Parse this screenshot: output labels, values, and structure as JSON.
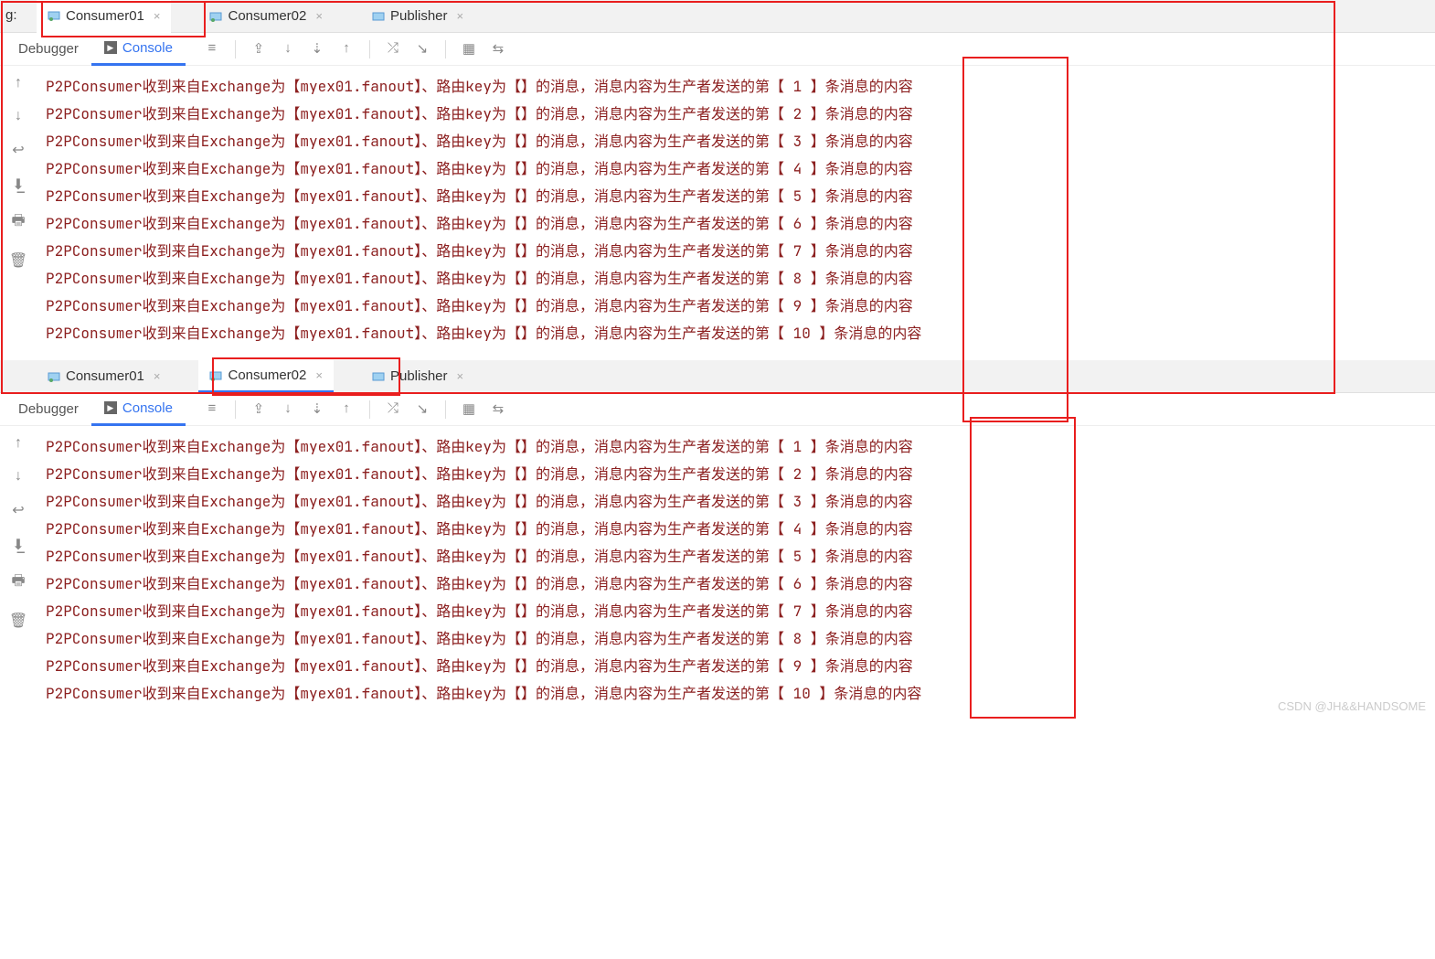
{
  "tabs": {
    "prefix": "g:",
    "t1": "Consumer01",
    "t2": "Consumer02",
    "t3": "Publisher"
  },
  "toolTabs": {
    "debugger": "Debugger",
    "console": "Console"
  },
  "console1": {
    "lines": [
      "P2PConsumer收到来自Exchange为【myex01.fanout】、路由key为【】的消息，消息内容为生产者发送的第【 1 】条消息的内容",
      "P2PConsumer收到来自Exchange为【myex01.fanout】、路由key为【】的消息，消息内容为生产者发送的第【 2 】条消息的内容",
      "P2PConsumer收到来自Exchange为【myex01.fanout】、路由key为【】的消息，消息内容为生产者发送的第【 3 】条消息的内容",
      "P2PConsumer收到来自Exchange为【myex01.fanout】、路由key为【】的消息，消息内容为生产者发送的第【 4 】条消息的内容",
      "P2PConsumer收到来自Exchange为【myex01.fanout】、路由key为【】的消息，消息内容为生产者发送的第【 5 】条消息的内容",
      "P2PConsumer收到来自Exchange为【myex01.fanout】、路由key为【】的消息，消息内容为生产者发送的第【 6 】条消息的内容",
      "P2PConsumer收到来自Exchange为【myex01.fanout】、路由key为【】的消息，消息内容为生产者发送的第【 7 】条消息的内容",
      "P2PConsumer收到来自Exchange为【myex01.fanout】、路由key为【】的消息，消息内容为生产者发送的第【 8 】条消息的内容",
      "P2PConsumer收到来自Exchange为【myex01.fanout】、路由key为【】的消息，消息内容为生产者发送的第【 9 】条消息的内容",
      "P2PConsumer收到来自Exchange为【myex01.fanout】、路由key为【】的消息，消息内容为生产者发送的第【 10 】条消息的内容"
    ]
  },
  "console2": {
    "lines": [
      "P2PConsumer收到来自Exchange为【myex01.fanout】、路由key为【】的消息，消息内容为生产者发送的第【 1 】条消息的内容",
      "P2PConsumer收到来自Exchange为【myex01.fanout】、路由key为【】的消息，消息内容为生产者发送的第【 2 】条消息的内容",
      "P2PConsumer收到来自Exchange为【myex01.fanout】、路由key为【】的消息，消息内容为生产者发送的第【 3 】条消息的内容",
      "P2PConsumer收到来自Exchange为【myex01.fanout】、路由key为【】的消息，消息内容为生产者发送的第【 4 】条消息的内容",
      "P2PConsumer收到来自Exchange为【myex01.fanout】、路由key为【】的消息，消息内容为生产者发送的第【 5 】条消息的内容",
      "P2PConsumer收到来自Exchange为【myex01.fanout】、路由key为【】的消息，消息内容为生产者发送的第【 6 】条消息的内容",
      "P2PConsumer收到来自Exchange为【myex01.fanout】、路由key为【】的消息，消息内容为生产者发送的第【 7 】条消息的内容",
      "P2PConsumer收到来自Exchange为【myex01.fanout】、路由key为【】的消息，消息内容为生产者发送的第【 8 】条消息的内容",
      "P2PConsumer收到来自Exchange为【myex01.fanout】、路由key为【】的消息，消息内容为生产者发送的第【 9 】条消息的内容",
      "P2PConsumer收到来自Exchange为【myex01.fanout】、路由key为【】的消息，消息内容为生产者发送的第【 10 】条消息的内容"
    ]
  },
  "watermark": "CSDN @JH&&HANDSOME"
}
